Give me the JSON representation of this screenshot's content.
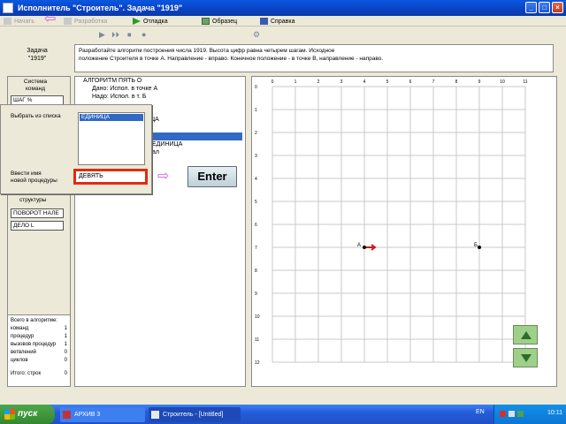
{
  "window": {
    "title": "Исполнитель \"Строитель\". Задача \"1919\"",
    "buttons": {
      "minimize": "_",
      "maximize": "□",
      "close": "×"
    }
  },
  "menu": [
    {
      "label": "Начать",
      "icon": "new-icon",
      "dim": true
    },
    {
      "label": "Разработка",
      "icon": "edit-icon",
      "dim": true
    },
    {
      "label": "Отладка",
      "icon": "play-icon",
      "dim": false
    },
    {
      "label": "Образец",
      "icon": "sample-icon",
      "dim": false
    },
    {
      "label": "Справка",
      "icon": "help-icon",
      "dim": false
    }
  ],
  "toolbar": {
    "run": "▶",
    "step": "⏵⏵",
    "stop": "⏹",
    "record": "●",
    "tool": "⚙"
  },
  "lesson": {
    "label": "Задача\n\"1919\""
  },
  "task": {
    "line1": "Разработайте алгоритм построения числа 1919. Высота цифр равна четырем шагам. Исходное",
    "line2": "положение Строителя в точке А. Направление - вправо. Конечное положение - в точке В, направление - направо."
  },
  "left_panel": {
    "head": "Система\nкоманд",
    "btn1": "ШАГ           %",
    "btn2": "ПОВОРОТ НАЛЕ",
    "btn3": "ДЕЛО         L",
    "struct": "структуры",
    "summary_title": "Всего в алгоритме:",
    "summary_rows": [
      {
        "k": "команд",
        "v": "1"
      },
      {
        "k": "процедур",
        "v": "1"
      },
      {
        "k": "вызовов процедур",
        "v": "1"
      },
      {
        "k": "ветвлений",
        "v": "0"
      },
      {
        "k": "циклов",
        "v": "0"
      },
      {
        "k": "Итого: строк",
        "v": "0"
      }
    ]
  },
  "algorithm": {
    "lines": [
      "АЛГОРИТМ ПЯТЬ О",
      "Дано: Испол. в точке А",
      "Надо: Испол. в т. Б",
      "ЦА",
      "ПРОЦЕДУРА ДЕВЯТЬ",
      "ЕДИНИЦА",
      "ал"
    ],
    "selected_line": ""
  },
  "popup": {
    "choose_label": "Выбрать из списка",
    "list_items": [
      "ЕДИНИЦА"
    ],
    "enter_label": "Ввести имя\nновой процедуры",
    "input_value": "ДЕВЯТЬ"
  },
  "enter_button": "Enter",
  "grid": {
    "x_ticks": [
      "0",
      "1",
      "2",
      "3",
      "4",
      "5",
      "6",
      "7",
      "8",
      "9",
      "10",
      "11"
    ],
    "y_ticks": [
      "0",
      "1",
      "2",
      "3",
      "4",
      "5",
      "6",
      "7",
      "8",
      "9",
      "10",
      "11",
      "12"
    ],
    "point_a": "A",
    "point_b": "Б"
  },
  "nav": {
    "up": "▲",
    "down": "▼"
  },
  "taskbar": {
    "start": "пуск",
    "items": [
      "АРХИВ 3",
      "Строитель - [Untitled]"
    ],
    "lang": "EN",
    "clock": "10:11"
  },
  "colors": {
    "selection": "#316ac5",
    "input_border": "#e22b10",
    "grid_line": "#c8c8c8",
    "nav_green": "#9ed08a"
  }
}
